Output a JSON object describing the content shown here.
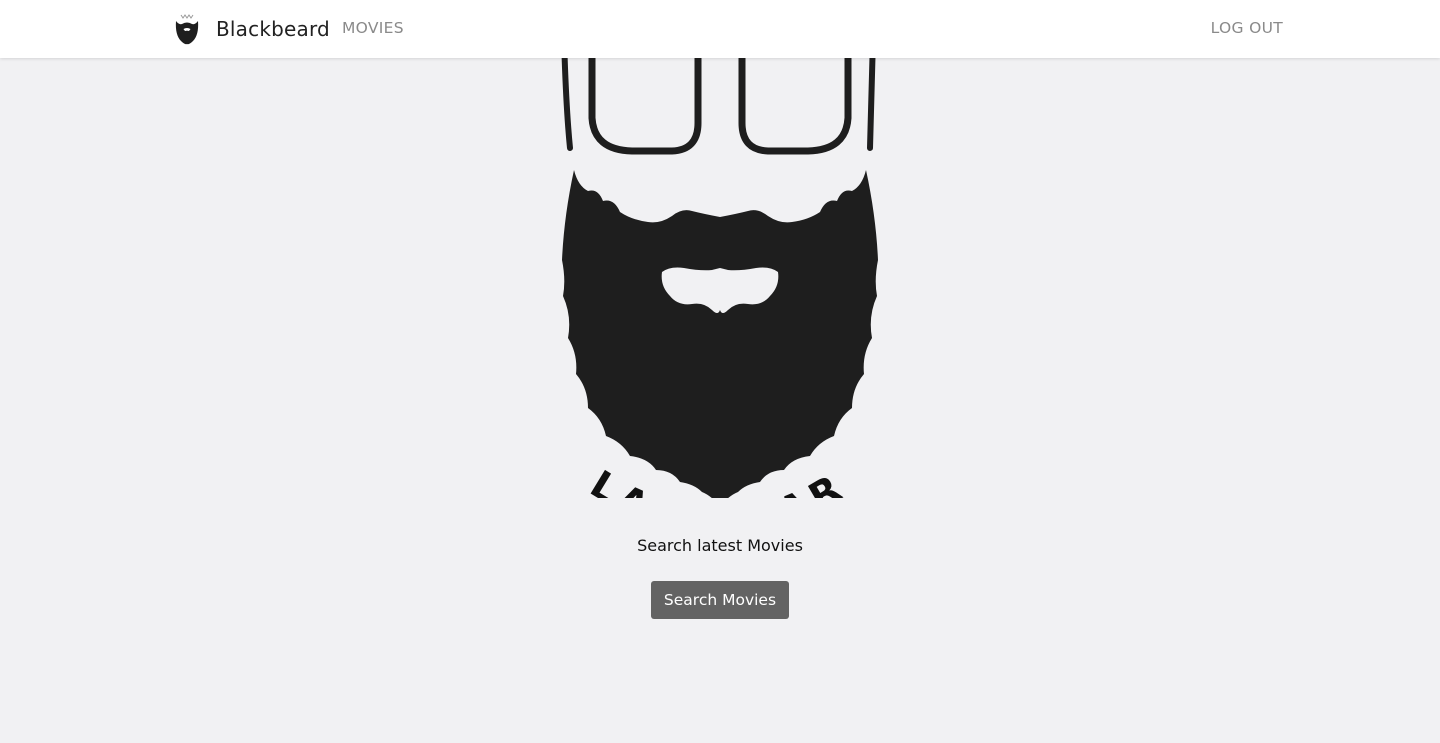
{
  "navbar": {
    "brand_name": "Blackbeard",
    "brand_icon": "beard-logo-icon",
    "links": {
      "movies": "MOVIES",
      "logout": "LOG OUT"
    }
  },
  "hero": {
    "logo_icon": "blackbeard-logo",
    "logo_text": "BLACKBEARD",
    "tagline": "Search latest Movies",
    "cta_label": "Search Movies"
  },
  "colors": {
    "background": "#f1f1f3",
    "navbar_bg": "#ffffff",
    "nav_link": "#8a8a8a",
    "logo_black": "#1e1e1e",
    "button_bg": "#636363",
    "button_text": "#ffffff"
  }
}
